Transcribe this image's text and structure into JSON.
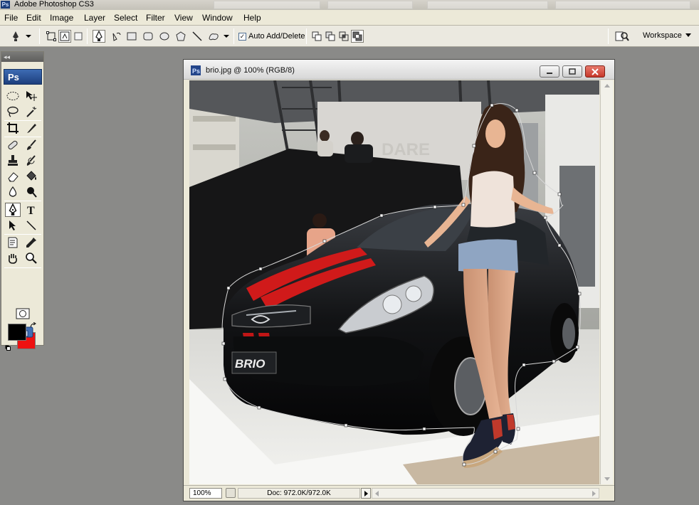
{
  "app": {
    "title": "Adobe Photoshop CS3",
    "badge": "Ps"
  },
  "menu": [
    "File",
    "Edit",
    "Image",
    "Layer",
    "Select",
    "Filter",
    "View",
    "Window",
    "Help"
  ],
  "options_bar": {
    "auto_add_delete_label": "Auto Add/Delete",
    "auto_add_delete_checked": true,
    "workspace_label": "Workspace"
  },
  "toolbox": {
    "logo": "Ps",
    "foreground_color": "#000000",
    "background_color": "#ee1111"
  },
  "document": {
    "title": "brio.jpg @ 100% (RGB/8)",
    "zoom": "100%",
    "doc_size": "Doc: 972.0K/972.0K",
    "car_badge": "BRIO",
    "backdrop_text": "DARE"
  }
}
